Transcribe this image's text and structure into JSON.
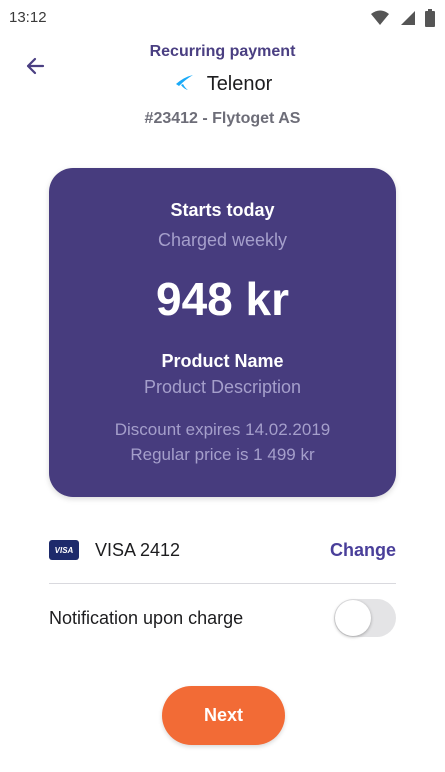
{
  "status_bar": {
    "time": "13:12"
  },
  "header": {
    "title": "Recurring payment",
    "merchant": "Telenor",
    "order_ref": "#23412 - Flytoget AS"
  },
  "card": {
    "starts": "Starts today",
    "frequency": "Charged weekly",
    "amount": "948 kr",
    "product_name": "Product Name",
    "product_description": "Product Description",
    "discount": "Discount expires 14.02.2019",
    "regular_price": "Regular price is 1 499 kr"
  },
  "payment": {
    "brand_badge": "VISA",
    "card_label": "VISA 2412",
    "change_label": "Change"
  },
  "notification": {
    "label": "Notification upon charge",
    "enabled": false
  },
  "actions": {
    "next_label": "Next"
  },
  "colors": {
    "primary": "#4a3f82",
    "card_bg": "#473c7e",
    "accent": "#f26b36",
    "telenor_blue": "#19aaf8"
  }
}
